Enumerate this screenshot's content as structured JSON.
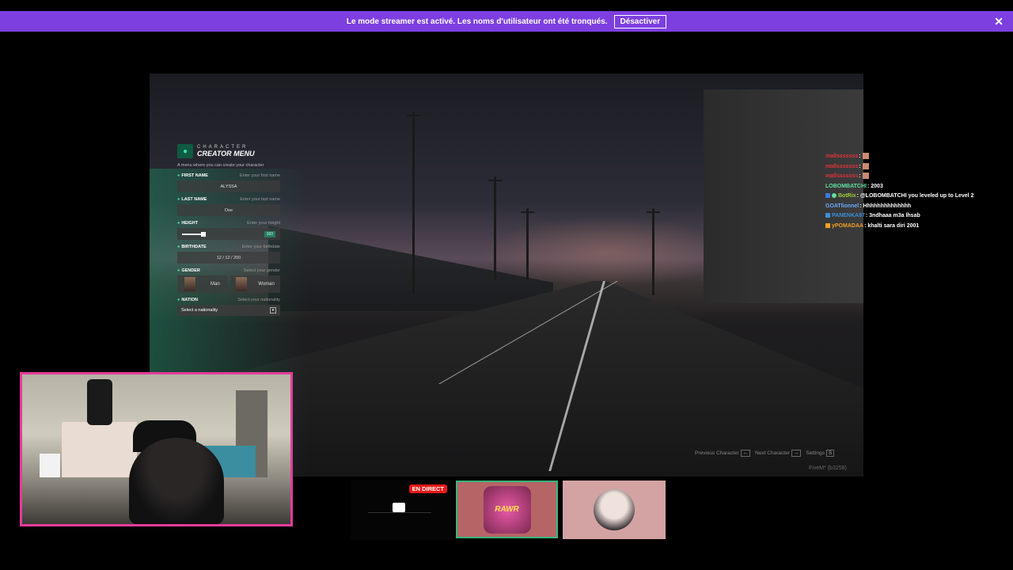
{
  "banner": {
    "message": "Le mode streamer est activé. Les noms d'utilisateur ont été tronqués.",
    "button_label": "Désactiver",
    "close_glyph": "✕",
    "color": "#7d3fe0"
  },
  "creator": {
    "title_top": "CHARACTER",
    "title_main": "CREATOR MENU",
    "subtitle": "A menu where you can create your character",
    "accent": "#3fe0a7",
    "first_name": {
      "label": "FIRST NAME",
      "hint": "Enter your first name",
      "value": "ALYSSA"
    },
    "last_name": {
      "label": "LAST NAME",
      "hint": "Enter your last name",
      "value": "Doe"
    },
    "height": {
      "label": "HEIGHT",
      "hint": "Enter your height",
      "value": "160"
    },
    "birthdate": {
      "label": "BIRTHDATE",
      "hint": "Enter your birthdate",
      "value": "12 / 12 / 200"
    },
    "gender": {
      "label": "GENDER",
      "hint": "Select your gender",
      "options": [
        "Man",
        "Woman"
      ]
    },
    "nation": {
      "label": "NATION",
      "hint": "Select your nationality",
      "placeholder": "Select a nationality"
    }
  },
  "chat": [
    {
      "user": "mallsssssss",
      "color": "#e0313a",
      "text": ""
    },
    {
      "user": "mallsssssss",
      "color": "#e0313a",
      "text": ""
    },
    {
      "user": "mallsssssss",
      "color": "#e0313a",
      "text": ""
    },
    {
      "user": "LOBOMBATCHI",
      "color": "#5ee2a0",
      "text": ": 2003"
    },
    {
      "user": "BotRix",
      "color": "#9acd32",
      "text": ": @LOBOMBATCHI you leveled up to Level 2"
    },
    {
      "user": "GOATlionnel",
      "color": "#6aa9ff",
      "text": ": Hhhhhhhhhhhhhh"
    },
    {
      "user": "PANENKA97",
      "color": "#3c8fd6",
      "text": ": 3ndhaaa m3a lhsab"
    },
    {
      "user": "yPOMADAA",
      "color": "#f0a020",
      "text": ": khalti sara diri 2001"
    }
  ],
  "hints": {
    "prev": "Previous Character",
    "next": "Next Character",
    "settings": "Settings",
    "settings_key": "S",
    "fivem": "FiveM* (b3258)"
  },
  "live_badge": "EN DIRECT",
  "card2_art": "RAWR",
  "webcam_border": "#e23c9a"
}
